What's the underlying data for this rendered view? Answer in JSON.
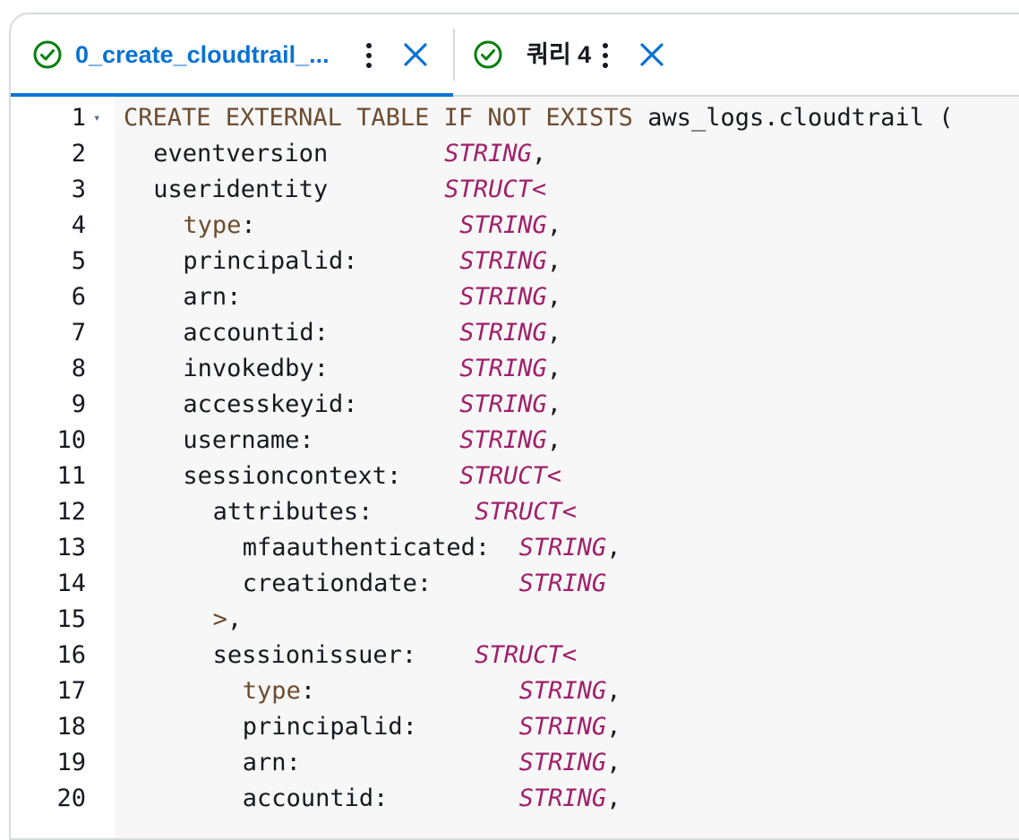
{
  "tabs": [
    {
      "label": "0_create_cloudtrail_...",
      "status": "success",
      "active": true
    },
    {
      "label": "쿼리 4",
      "status": "success",
      "active": false
    }
  ],
  "colors": {
    "accent": "#0972d3",
    "success": "#037f0c",
    "keyword": "#6d4c2f",
    "type": "#a0206b"
  },
  "editor": {
    "lines": [
      {
        "n": "1",
        "fold": "▾",
        "indent": 0,
        "tokens": [
          {
            "t": "CREATE EXTERNAL TABLE IF NOT EXISTS",
            "c": "kw"
          },
          {
            "t": " aws_logs.cloudtrail (",
            "c": ""
          }
        ]
      },
      {
        "n": "2",
        "indent": 2,
        "tokens": [
          {
            "t": "eventversion        ",
            "c": ""
          },
          {
            "t": "STRING",
            "c": "ty"
          },
          {
            "t": ",",
            "c": ""
          }
        ]
      },
      {
        "n": "3",
        "indent": 2,
        "tokens": [
          {
            "t": "useridentity        ",
            "c": ""
          },
          {
            "t": "STRUCT<",
            "c": "ty"
          }
        ]
      },
      {
        "n": "4",
        "indent": 4,
        "tokens": [
          {
            "t": "type",
            "c": "kw"
          },
          {
            "t": ":              ",
            "c": ""
          },
          {
            "t": "STRING",
            "c": "ty"
          },
          {
            "t": ",",
            "c": ""
          }
        ]
      },
      {
        "n": "5",
        "indent": 4,
        "tokens": [
          {
            "t": "principalid:       ",
            "c": ""
          },
          {
            "t": "STRING",
            "c": "ty"
          },
          {
            "t": ",",
            "c": ""
          }
        ]
      },
      {
        "n": "6",
        "indent": 4,
        "tokens": [
          {
            "t": "arn:               ",
            "c": ""
          },
          {
            "t": "STRING",
            "c": "ty"
          },
          {
            "t": ",",
            "c": ""
          }
        ]
      },
      {
        "n": "7",
        "indent": 4,
        "tokens": [
          {
            "t": "accountid:         ",
            "c": ""
          },
          {
            "t": "STRING",
            "c": "ty"
          },
          {
            "t": ",",
            "c": ""
          }
        ]
      },
      {
        "n": "8",
        "indent": 4,
        "tokens": [
          {
            "t": "invokedby:         ",
            "c": ""
          },
          {
            "t": "STRING",
            "c": "ty"
          },
          {
            "t": ",",
            "c": ""
          }
        ]
      },
      {
        "n": "9",
        "indent": 4,
        "tokens": [
          {
            "t": "accesskeyid:       ",
            "c": ""
          },
          {
            "t": "STRING",
            "c": "ty"
          },
          {
            "t": ",",
            "c": ""
          }
        ]
      },
      {
        "n": "10",
        "indent": 4,
        "tokens": [
          {
            "t": "username:          ",
            "c": ""
          },
          {
            "t": "STRING",
            "c": "ty"
          },
          {
            "t": ",",
            "c": ""
          }
        ]
      },
      {
        "n": "11",
        "indent": 4,
        "tokens": [
          {
            "t": "sessioncontext:    ",
            "c": ""
          },
          {
            "t": "STRUCT<",
            "c": "ty"
          }
        ]
      },
      {
        "n": "12",
        "indent": 6,
        "tokens": [
          {
            "t": "attributes:       ",
            "c": ""
          },
          {
            "t": "STRUCT<",
            "c": "ty"
          }
        ]
      },
      {
        "n": "13",
        "indent": 8,
        "tokens": [
          {
            "t": "mfaauthenticated:  ",
            "c": ""
          },
          {
            "t": "STRING",
            "c": "ty"
          },
          {
            "t": ",",
            "c": ""
          }
        ]
      },
      {
        "n": "14",
        "indent": 8,
        "tokens": [
          {
            "t": "creationdate:      ",
            "c": ""
          },
          {
            "t": "STRING",
            "c": "ty"
          }
        ]
      },
      {
        "n": "15",
        "indent": 6,
        "tokens": [
          {
            "t": ">",
            "c": "br"
          },
          {
            "t": ",",
            "c": ""
          }
        ]
      },
      {
        "n": "16",
        "indent": 6,
        "tokens": [
          {
            "t": "sessionissuer:    ",
            "c": ""
          },
          {
            "t": "STRUCT<",
            "c": "ty"
          }
        ]
      },
      {
        "n": "17",
        "indent": 8,
        "tokens": [
          {
            "t": "type",
            "c": "kw"
          },
          {
            "t": ":              ",
            "c": ""
          },
          {
            "t": "STRING",
            "c": "ty"
          },
          {
            "t": ",",
            "c": ""
          }
        ]
      },
      {
        "n": "18",
        "indent": 8,
        "tokens": [
          {
            "t": "principalid:       ",
            "c": ""
          },
          {
            "t": "STRING",
            "c": "ty"
          },
          {
            "t": ",",
            "c": ""
          }
        ]
      },
      {
        "n": "19",
        "indent": 8,
        "tokens": [
          {
            "t": "arn:               ",
            "c": ""
          },
          {
            "t": "STRING",
            "c": "ty"
          },
          {
            "t": ",",
            "c": ""
          }
        ]
      },
      {
        "n": "20",
        "indent": 8,
        "tokens": [
          {
            "t": "accountid:         ",
            "c": ""
          },
          {
            "t": "STRING",
            "c": "ty"
          },
          {
            "t": ",",
            "c": ""
          }
        ]
      }
    ]
  }
}
